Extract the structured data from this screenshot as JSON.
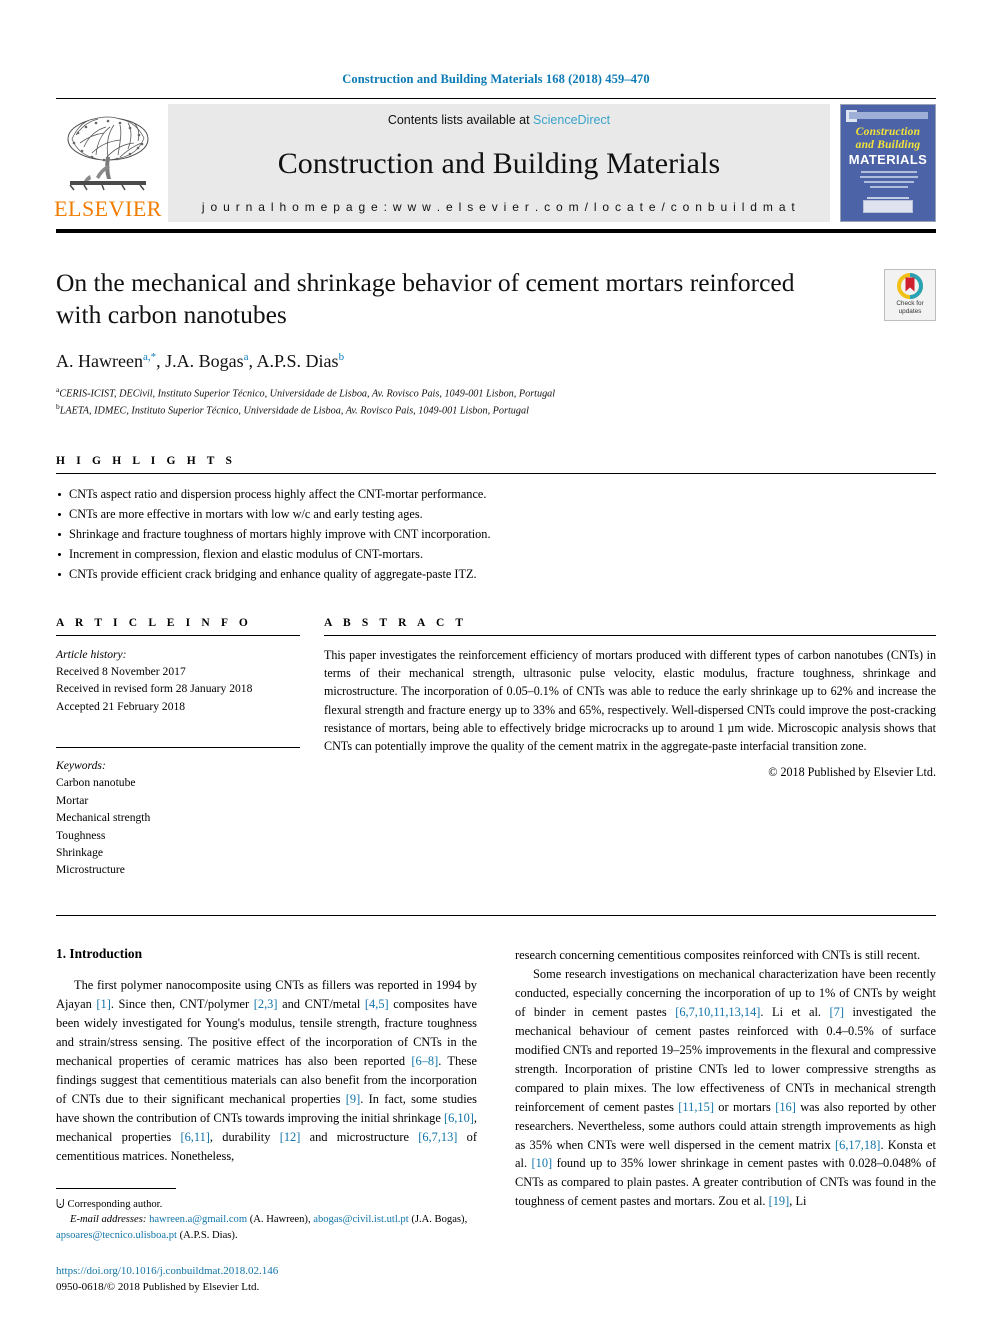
{
  "running_head": "Construction and Building Materials 168 (2018) 459–470",
  "masthead": {
    "publisher_name": "ELSEVIER",
    "contents_prefix": "Contents lists available at ",
    "contents_link": "ScienceDirect",
    "journal_name": "Construction and Building Materials",
    "homepage_label": "j o u r n a l   h o m e p a g e :   w w w . e l s e v i e r . c o m / l o c a t e / c o n b u i l d m a t",
    "cover": {
      "line1": "Construction",
      "line2": "and Building",
      "line3": "MATERIALS"
    }
  },
  "article": {
    "title": "On the mechanical and shrinkage behavior of cement mortars reinforced with carbon nanotubes",
    "authors_html": "A. Hawreen, J.A. Bogas, A.P.S. Dias",
    "authors_parts": {
      "a1_name": "A. Hawreen",
      "a1_sup": "a,*",
      "sep1": ", ",
      "a2_name": "J.A. Bogas",
      "a2_sup": "a",
      "sep2": ", ",
      "a3_name": "A.P.S. Dias",
      "a3_sup": "b"
    },
    "affiliations": [
      {
        "sup": "a",
        "text": "CERIS-ICIST, DECivil, Instituto Superior Técnico, Universidade de Lisboa, Av. Rovisco Pais, 1049-001 Lisbon, Portugal"
      },
      {
        "sup": "b",
        "text": "LAETA, IDMEC, Instituto Superior Técnico, Universidade de Lisboa, Av. Rovisco Pais, 1049-001 Lisbon, Portugal"
      }
    ],
    "crossmark": {
      "line1": "Check for",
      "line2": "updates"
    }
  },
  "highlights": {
    "heading": "H I G H L I G H T S",
    "items": [
      "CNTs aspect ratio and dispersion process highly affect the CNT-mortar performance.",
      "CNTs are more effective in mortars with low w/c and early testing ages.",
      "Shrinkage and fracture toughness of mortars highly improve with CNT incorporation.",
      "Increment in compression, flexion and elastic modulus of CNT-mortars.",
      "CNTs provide efficient crack bridging and enhance quality of aggregate-paste ITZ."
    ]
  },
  "article_info": {
    "heading": "A R T I C L E   I N F O",
    "history_label": "Article history:",
    "history": [
      "Received 8 November 2017",
      "Received in revised form 28 January 2018",
      "Accepted 21 February 2018"
    ],
    "keywords_label": "Keywords:",
    "keywords": [
      "Carbon nanotube",
      "Mortar",
      "Mechanical strength",
      "Toughness",
      "Shrinkage",
      "Microstructure"
    ]
  },
  "abstract": {
    "heading": "A B S T R A C T",
    "text": "This paper investigates the reinforcement efficiency of mortars produced with different types of carbon nanotubes (CNTs) in terms of their mechanical strength, ultrasonic pulse velocity, elastic modulus, fracture toughness, shrinkage and microstructure. The incorporation of 0.05–0.1% of CNTs was able to reduce the early shrinkage up to 62% and increase the flexural strength and fracture energy up to 33% and 65%, respectively. Well-dispersed CNTs could improve the post-cracking resistance of mortars, being able to effectively bridge microcracks up to around 1 µm wide. Microscopic analysis shows that CNTs can potentially improve the quality of the cement matrix in the aggregate-paste interfacial transition zone.",
    "copyright": "© 2018 Published by Elsevier Ltd."
  },
  "body": {
    "section_heading": "1. Introduction",
    "left_paragraphs": [
      "The first polymer nanocomposite using CNTs as fillers was reported in 1994 by Ajayan [1]. Since then, CNT/polymer [2,3] and CNT/metal [4,5] composites have been widely investigated for Young's modulus, tensile strength, fracture toughness and strain/stress sensing. The positive effect of the incorporation of CNTs in the mechanical properties of ceramic matrices has also been reported [6–8]. These findings suggest that cementitious materials can also benefit from the incorporation of CNTs due to their significant mechanical properties [9]. In fact, some studies have shown the contribution of CNTs towards improving the initial shrinkage [6,10], mechanical properties [6,11], durability [12] and microstructure [6,7,13] of cementitious matrices. Nonetheless,"
    ],
    "right_paragraphs": [
      "research concerning cementitious composites reinforced with CNTs is still recent.",
      "Some research investigations on mechanical characterization have been recently conducted, especially concerning the incorporation of up to 1% of CNTs by weight of binder in cement pastes [6,7,10,11,13,14]. Li et al. [7] investigated the mechanical behaviour of cement pastes reinforced with 0.4–0.5% of surface modified CNTs and reported 19–25% improvements in the flexural and compressive strength. Incorporation of pristine CNTs led to lower compressive strengths as compared to plain mixes. The low effectiveness of CNTs in mechanical strength reinforcement of cement pastes [11,15] or mortars [16] was also reported by other researchers. Nevertheless, some authors could attain strength improvements as high as 35% when CNTs were well dispersed in the cement matrix [6,17,18]. Konsta et al. [10] found up to 35% lower shrinkage in cement pastes with 0.028–0.048% of CNTs as compared to plain pastes. A greater contribution of CNTs was found in the toughness of cement pastes and mortars. Zou et al. [19], Li"
    ]
  },
  "footnote": {
    "corresponding_marker": "⨃",
    "corresponding_text": "Corresponding author.",
    "email_label": "E-mail addresses:",
    "emails": [
      {
        "address": "hawreen.a@gmail.com",
        "owner": "(A. Hawreen)"
      },
      {
        "address": "abogas@civil.ist.utl.pt",
        "owner": "(J.A. Bogas)"
      },
      {
        "address": "apsoares@tecnico.ulisboa.pt",
        "owner": "(A.P.S. Dias)"
      }
    ],
    "doi": "https://doi.org/10.1016/j.conbuildmat.2018.02.146",
    "issn_line": "0950-0618/© 2018 Published by Elsevier Ltd."
  },
  "colors": {
    "link_blue": "#1274a8",
    "header_blue": "#0b7ab5",
    "sciencedirect_blue": "#3ba3cc",
    "elsevier_orange": "#f07c00",
    "cover_blue": "#4c63a8",
    "cover_yellow": "#f3e23a"
  }
}
